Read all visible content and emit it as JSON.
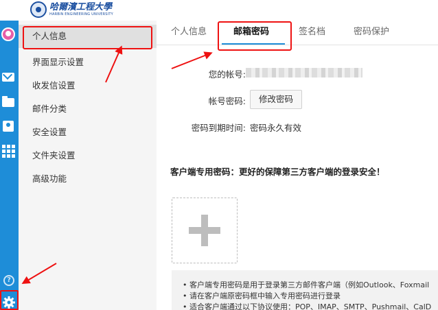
{
  "header": {
    "logo_cn": "哈爾濱工程大學",
    "logo_en": "HARBIN ENGINEERING UNIVERSITY"
  },
  "rail": {
    "icons": [
      "back-icon",
      "avatar",
      "mail-icon",
      "folder-icon",
      "contacts-icon",
      "apps-icon",
      "help-icon",
      "settings-icon"
    ]
  },
  "sidebar": {
    "items": [
      {
        "label": "个人信息",
        "active": true
      },
      {
        "label": "界面显示设置"
      },
      {
        "label": "收发信设置"
      },
      {
        "label": "邮件分类"
      },
      {
        "label": "安全设置"
      },
      {
        "label": "文件夹设置"
      },
      {
        "label": "高级功能"
      }
    ]
  },
  "tabs": [
    {
      "label": "个人信息"
    },
    {
      "label": "邮箱密码",
      "active": true
    },
    {
      "label": "签名档"
    },
    {
      "label": "密码保护"
    }
  ],
  "form": {
    "account_label": "您的帐号:",
    "password_label": "帐号密码:",
    "change_password_button": "修改密码",
    "expiry_label": "密码到期时间:",
    "expiry_value": "密码永久有效"
  },
  "client_password": {
    "title": "客户端专用密码：更好的保障第三方客户端的登录安全！",
    "notes": [
      "• 客户端专用密码是用于登录第三方邮件客户端（例如Outlook、Foxmail",
      "• 请在客户端原密码框中输入专用密码进行登录",
      "• 适合客户端通过以下协议使用：POP、IMAP、SMTP、Pushmail、CalD"
    ]
  },
  "colors": {
    "accent": "#1e8dd8",
    "highlight": "#e11111"
  }
}
